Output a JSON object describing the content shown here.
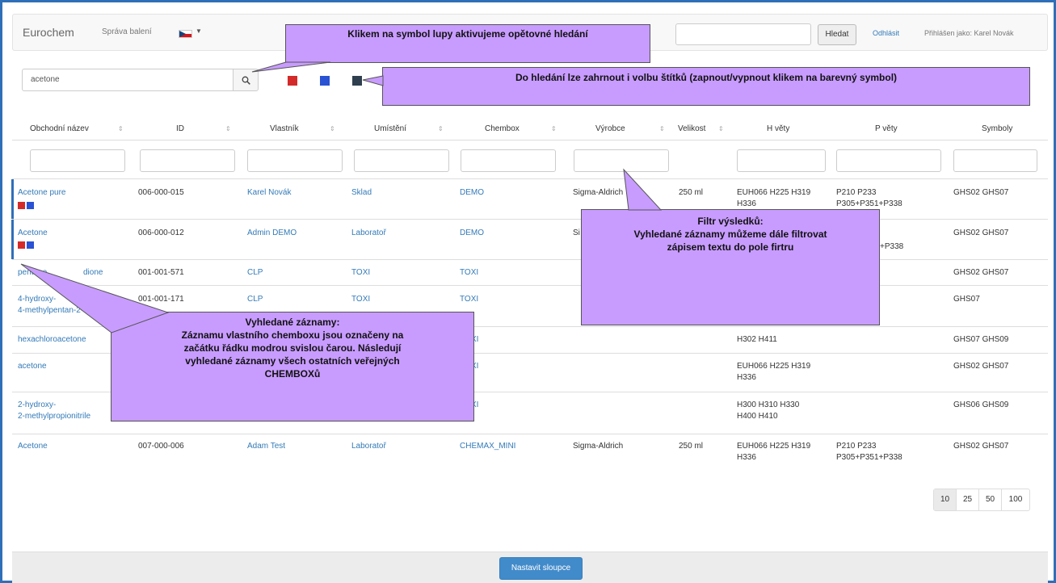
{
  "navbar": {
    "brand": "Eurochem",
    "nav_link": "Správa balení",
    "search_button": "Hledat",
    "logout": "Odhlásit",
    "logged_in": "Přihlášen jako: Karel Novák"
  },
  "search": {
    "value": "acetone"
  },
  "tags": [
    {
      "color": "#d42a2a"
    },
    {
      "color": "#2a52d4"
    },
    {
      "color": "#2f3f4f"
    }
  ],
  "table": {
    "headers": [
      "Obchodní název",
      "ID",
      "Vlastník",
      "Umístění",
      "Chembox",
      "Výrobce",
      "Velikost",
      "H věty",
      "P věty",
      "Symboly"
    ],
    "rows": [
      {
        "name": "Acetone pure",
        "id": "006-000-015",
        "owner": "Karel Novák",
        "location": "Sklad",
        "chembox": "DEMO",
        "maker": "Sigma-Aldrich",
        "size": "250 ml",
        "h1": "EUH066 H225 H319",
        "h2": "H336",
        "p1": "P210 P233",
        "p2": "P305+P351+P338",
        "symbols": "GHS02 GHS07"
      },
      {
        "name": "Acetone",
        "id": "006-000-012",
        "owner": "Admin DEMO",
        "location": "Laboratoř",
        "chembox": "DEMO",
        "maker": "Si",
        "size": "",
        "h1": "",
        "h2": "",
        "p1": "",
        "p2": "+P338",
        "symbols": "GHS02 GHS07"
      },
      {
        "name": "pentane-2,4-dione",
        "name_visible": "pentane",
        "name_tail": "dione",
        "id": "001-001-571",
        "owner": "CLP",
        "location": "TOXI",
        "chembox": "TOXI",
        "symbols": "GHS02 GHS07"
      },
      {
        "name1": "4-hydroxy-",
        "name2": "4-methylpentan-2-one",
        "id": "001-001-171",
        "owner": "CLP",
        "location": "TOXI",
        "chembox": "TOXI",
        "symbols": "GHS07"
      },
      {
        "name": "hexachloroacetone",
        "chembox": "XI",
        "h1": "H302 H411",
        "symbols": "GHS07 GHS09"
      },
      {
        "name": "acetone",
        "chembox": "XI",
        "h1": "EUH066 H225 H319",
        "h2": "H336",
        "symbols": "GHS02 GHS07"
      },
      {
        "name1": "2-hydroxy-",
        "name2": "2-methylpropionitrile",
        "chembox": "XI",
        "h1": "H300 H310 H330",
        "h2": "H400 H410",
        "symbols": "GHS06 GHS09"
      },
      {
        "name": "Acetone",
        "id": "007-000-006",
        "owner": "Adam Test",
        "location": "Laboratoř",
        "chembox": "CHEMAX_MINI",
        "maker": "Sigma-Aldrich",
        "size": "250 ml",
        "h1": "EUH066 H225 H319",
        "h2": "H336",
        "p1": "P210 P233",
        "p2": "P305+P351+P338",
        "symbols": "GHS02 GHS07"
      }
    ]
  },
  "pagination": [
    "10",
    "25",
    "50",
    "100"
  ],
  "footer": {
    "columns_button": "Nastavit sloupce"
  },
  "callouts": {
    "search_icon": "Klikem na symbol lupy aktivujeme opětovné hledání",
    "tags": "Do hledání lze zahrnout i volbu štítků (zapnout/vypnout klikem na barevný symbol)",
    "filter_title": "Filtr výsledků:",
    "filter_line1": "Vyhledané záznamy můžeme dále filtrovat",
    "filter_line2": "zápisem textu do pole firtru",
    "results_title": "Vyhledané záznamy:",
    "results_line1": "Záznamu vlastního chemboxu jsou označeny na",
    "results_line2": "začátku řádku modrou svislou čarou. Následují",
    "results_line3": "vyhledané záznamy všech ostatních veřejných",
    "results_line4": "CHEMBOXů"
  }
}
